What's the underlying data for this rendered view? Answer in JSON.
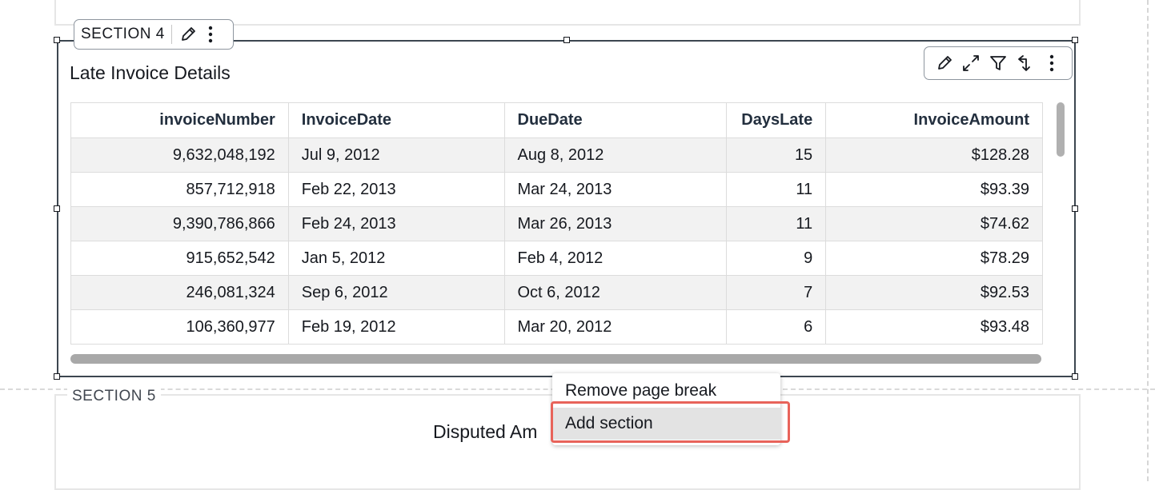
{
  "section4": {
    "label": "SECTION 4",
    "visual_title": "Late Invoice Details",
    "toolbar_icons": [
      "pencil-icon",
      "expand-icon",
      "filter-icon",
      "swap-icon",
      "more-vertical-icon"
    ]
  },
  "table": {
    "columns": [
      "invoiceNumber",
      "InvoiceDate",
      "DueDate",
      "DaysLate",
      "InvoiceAmount"
    ],
    "rows": [
      [
        "9,632,048,192",
        "Jul 9, 2012",
        "Aug 8, 2012",
        "15",
        "$128.28"
      ],
      [
        "857,712,918",
        "Feb 22, 2013",
        "Mar 24, 2013",
        "11",
        "$93.39"
      ],
      [
        "9,390,786,866",
        "Feb 24, 2013",
        "Mar 26, 2013",
        "11",
        "$74.62"
      ],
      [
        "915,652,542",
        "Jan 5, 2012",
        "Feb 4, 2012",
        "9",
        "$78.29"
      ],
      [
        "246,081,324",
        "Sep 6, 2012",
        "Oct 6, 2012",
        "7",
        "$92.53"
      ],
      [
        "106,360,977",
        "Feb 19, 2012",
        "Mar 20, 2012",
        "6",
        "$93.48"
      ]
    ]
  },
  "section5": {
    "label": "SECTION 5",
    "title_partial": "Disputed Am"
  },
  "context_menu": {
    "items": [
      "Remove page break",
      "Add section"
    ]
  },
  "colors": {
    "highlight": "#e8635a",
    "border_dark": "#3c4650",
    "row_shade": "#f2f2f2"
  }
}
